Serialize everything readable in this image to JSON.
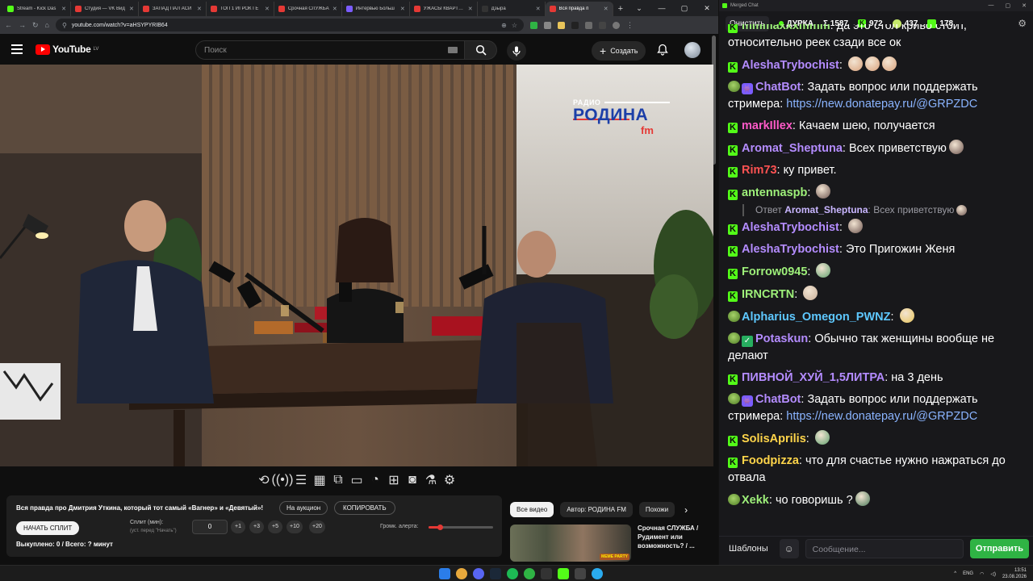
{
  "browser": {
    "tabs": [
      {
        "title": "Stream - Kick Das",
        "color": "#53fc18"
      },
      {
        "title": "Студия — VK Вид",
        "color": "#e53935"
      },
      {
        "title": "ЗАПАД ПАЛ АСИ",
        "color": "#e53935"
      },
      {
        "title": "ТОП 1 ИГРОК ГЕ",
        "color": "#e53935"
      },
      {
        "title": "Срочная СЛУЖБА",
        "color": "#e53935"
      },
      {
        "title": "Интервью Больш",
        "color": "#7b5cff"
      },
      {
        "title": "УЖАСЫ КВАРТИР",
        "color": "#e53935"
      },
      {
        "title": "Дзыра",
        "color": "#333333"
      },
      {
        "title": "Вся правда п",
        "color": "#e53935"
      }
    ],
    "url": "youtube.com/watch?v=aHSYPYRIB64"
  },
  "youtube": {
    "logo_text": "YouTube",
    "country_code": "LV",
    "search_placeholder": "Поиск",
    "create_label": "Создать"
  },
  "video": {
    "logo_small": "РАДИО",
    "logo_big": "РОДИНА",
    "logo_fm": "fm"
  },
  "stream_panel": {
    "title": "Вся правда про Дмитрия Уткина, который тот самый «Вагнер» и «Девятый»!",
    "auction_btn": "На аукцион",
    "copy_btn": "КОПИРОВАТЬ",
    "start_split_btn": "НАЧАТЬ СПЛИТ",
    "split_label": "Сплит (мин):",
    "split_hint": "(уст. перед \"Начать\")",
    "split_value": "0",
    "increments": [
      "+1",
      "+3",
      "+5",
      "+10",
      "+20"
    ],
    "volume_label": "Громк. алерта:",
    "volume_level": 0.18,
    "footer": "Выкуплено: 0 / Всего: ? минут"
  },
  "chips": [
    "Все видео",
    "Автор: РОДИНА FM",
    "Похожи"
  ],
  "recommendation": {
    "title": "Срочная СЛУЖБА / Рудимент или возможность? / ...",
    "overlay": "MEME PARTY"
  },
  "chat": {
    "window_title": "Merged Chat",
    "clear_btn": "Очистить",
    "channel": "ДУРКА",
    "total": "Σ 1587",
    "kick_count": "972",
    "other_count": "437",
    "third_count": "178",
    "messages": [
      {
        "badge": "kick",
        "user": "mmmaxxxmmm",
        "color": "#9ef07a",
        "text": "да это стол криво стоит, относительно реек сзади все ок",
        "cut": true
      },
      {
        "badge": "kick",
        "user": "AleshaTrybochist",
        "color": "#b48cff",
        "text": "",
        "emotes": [
          "#d9a27c",
          "#d9a27c",
          "#d9a27c"
        ]
      },
      {
        "badge": "pepe-bot",
        "user": "ChatBot",
        "color": "#b48cff",
        "text": "Задать вопрос или поддержать стримера: ",
        "link": "https://new.donatepay.ru/@GRPZDC"
      },
      {
        "badge": "kick",
        "user": "markIllex",
        "color": "#ff5ac8",
        "text": "Качаем шею, получается"
      },
      {
        "badge": "kick",
        "user": "Aromat_Sheptuna",
        "color": "#b48cff",
        "text": "Всех приветствую",
        "emotes": [
          "#6d5550"
        ]
      },
      {
        "badge": "kick",
        "user": "Rim73",
        "color": "#ff5252",
        "text": "ку привет."
      },
      {
        "badge": "kick",
        "user": "antennaspb",
        "color": "#9ef07a",
        "text": "",
        "emotes": [
          "#6d5550"
        ],
        "reply_user": "Aromat_Sheptuna",
        "reply_text": "Всех приветствую",
        "reply_prefix": "Ответ"
      },
      {
        "badge": "kick",
        "user": "AleshaTrybochist",
        "color": "#b48cff",
        "text": "",
        "emotes": [
          "#6d5550"
        ]
      },
      {
        "badge": "kick",
        "user": "AleshaTrybochist",
        "color": "#b48cff",
        "text": "Это Пригожин Женя"
      },
      {
        "badge": "kick",
        "user": "Forrow0945",
        "color": "#9ef07a",
        "text": "",
        "emotes": [
          "#5fa06e"
        ]
      },
      {
        "badge": "kick",
        "user": "IRNCRTN",
        "color": "#9ef07a",
        "text": "",
        "emotes": [
          "#c9b09a"
        ]
      },
      {
        "badge": "pepe",
        "user": "Alpharius_Omegon_PWNZ",
        "color": "#5ec8ff",
        "text": "",
        "emotes": [
          "#e8c45a"
        ]
      },
      {
        "badge": "pepe-check",
        "user": "Potaskun",
        "color": "#b48cff",
        "text": "Обычно так женщины вообще не делают"
      },
      {
        "badge": "kick",
        "user": "ПИВНОЙ_ХУЙ_1,5ЛИТРА",
        "color": "#b48cff",
        "text": "на 3 день"
      },
      {
        "badge": "pepe-bot",
        "user": "ChatBot",
        "color": "#b48cff",
        "text": "Задать вопрос или поддержать стримера: ",
        "link": "https://new.donatepay.ru/@GRPZDC"
      },
      {
        "badge": "kick",
        "user": "SolisAprilis",
        "color": "#ffd54a",
        "text": "",
        "emotes": [
          "#5fa06e"
        ]
      },
      {
        "badge": "kick",
        "user": "Foodpizza",
        "color": "#ffd54a",
        "text": "что для счастье нужно нажраться до отвала"
      },
      {
        "badge": "pepe",
        "user": "Xekk",
        "color": "#9ef07a",
        "text": "чо говоришь ?",
        "emotes": [
          "#4a7a5a"
        ]
      }
    ],
    "templates_btn": "Шаблоны",
    "input_placeholder": "Сообщение...",
    "send_btn": "Отправить"
  },
  "taskbar": {
    "lang": "ENG",
    "time": "13:51",
    "date": "23.08.2026"
  }
}
